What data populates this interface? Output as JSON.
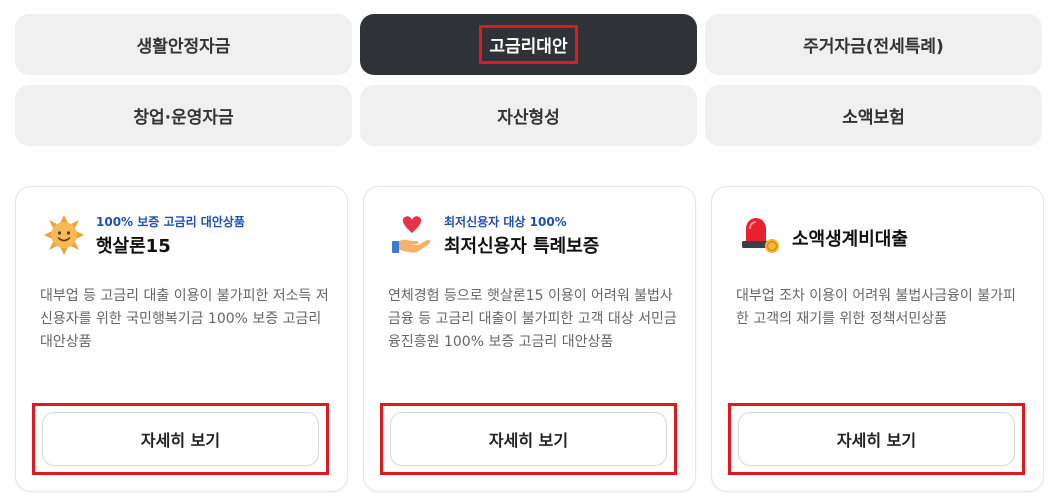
{
  "tabs": [
    {
      "label": "생활안정자금"
    },
    {
      "label": "고금리대안"
    },
    {
      "label": "주거자금(전세특례)"
    },
    {
      "label": "창업·운영자금"
    },
    {
      "label": "자산형성"
    },
    {
      "label": "소액보험"
    }
  ],
  "active_tab": "고금리대안",
  "cards": [
    {
      "icon": "sun-face-icon",
      "tagline": "100% 보증 고금리 대안상품",
      "title": "햇살론15",
      "desc": "대부업 등 고금리 대출 이용이 불가피한 저소득 저신용자를 위한 국민행복기금 100% 보증 고금리 대안상품",
      "button": "자세히 보기"
    },
    {
      "icon": "heart-hand-icon",
      "tagline": "최저신용자 대상 100%",
      "title": "최저신용자 특례보증",
      "desc": "연체경험 등으로 햇살론15 이용이 어려워 불법사금융 등 고금리 대출이 불가피한 고객 대상 서민금융진흥원 100% 보증 고금리 대안상품",
      "button": "자세히 보기"
    },
    {
      "icon": "siren-coin-icon",
      "tagline": "",
      "title": "소액생계비대출",
      "desc": "대부업 조차 이용이 어려워 불법사금융이 불가피한 고객의 재기를 위한 정책서민상품",
      "button": "자세히 보기"
    }
  ],
  "colors": {
    "active_tab_bg": "#2f3338",
    "tab_bg": "#f0f0f0",
    "tagline": "#1d4fb8",
    "highlight": "#e0191f"
  }
}
